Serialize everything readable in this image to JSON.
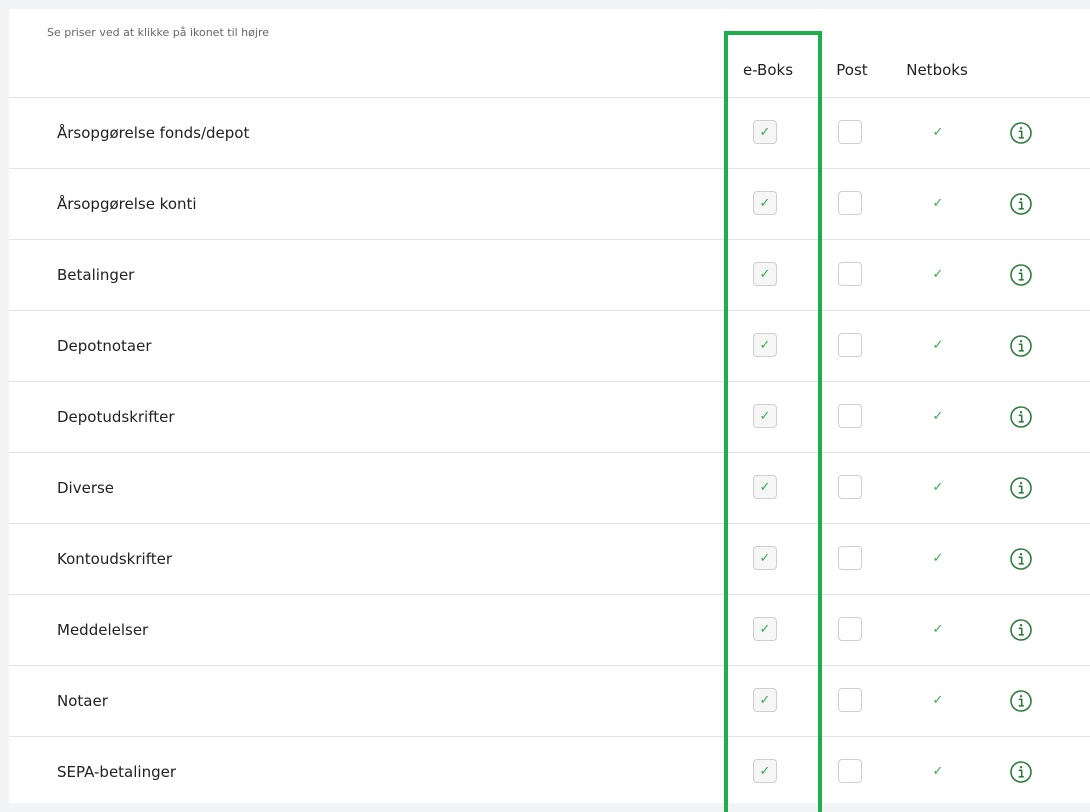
{
  "hint": "Se priser ved at klikke på ikonet til højre",
  "columns": {
    "eboks": "e-Boks",
    "post": "Post",
    "netboks": "Netboks"
  },
  "colors": {
    "highlight": "#1fae4b",
    "check": "#2fb04a",
    "info_icon": "#2e7d3c"
  },
  "icons": {
    "check": "check-icon",
    "info": "info-circle-icon"
  },
  "rows": [
    {
      "label": "Årsopgørelse fonds/depot",
      "eboks": true,
      "post": false,
      "netboks": true
    },
    {
      "label": "Årsopgørelse konti",
      "eboks": true,
      "post": false,
      "netboks": true
    },
    {
      "label": "Betalinger",
      "eboks": true,
      "post": false,
      "netboks": true
    },
    {
      "label": "Depotnotaer",
      "eboks": true,
      "post": false,
      "netboks": true
    },
    {
      "label": "Depotudskrifter",
      "eboks": true,
      "post": false,
      "netboks": true
    },
    {
      "label": "Diverse",
      "eboks": true,
      "post": false,
      "netboks": true
    },
    {
      "label": "Kontoudskrifter",
      "eboks": true,
      "post": false,
      "netboks": true
    },
    {
      "label": "Meddelelser",
      "eboks": true,
      "post": false,
      "netboks": true
    },
    {
      "label": "Notaer",
      "eboks": true,
      "post": false,
      "netboks": true
    },
    {
      "label": "SEPA-betalinger",
      "eboks": true,
      "post": false,
      "netboks": true
    }
  ]
}
